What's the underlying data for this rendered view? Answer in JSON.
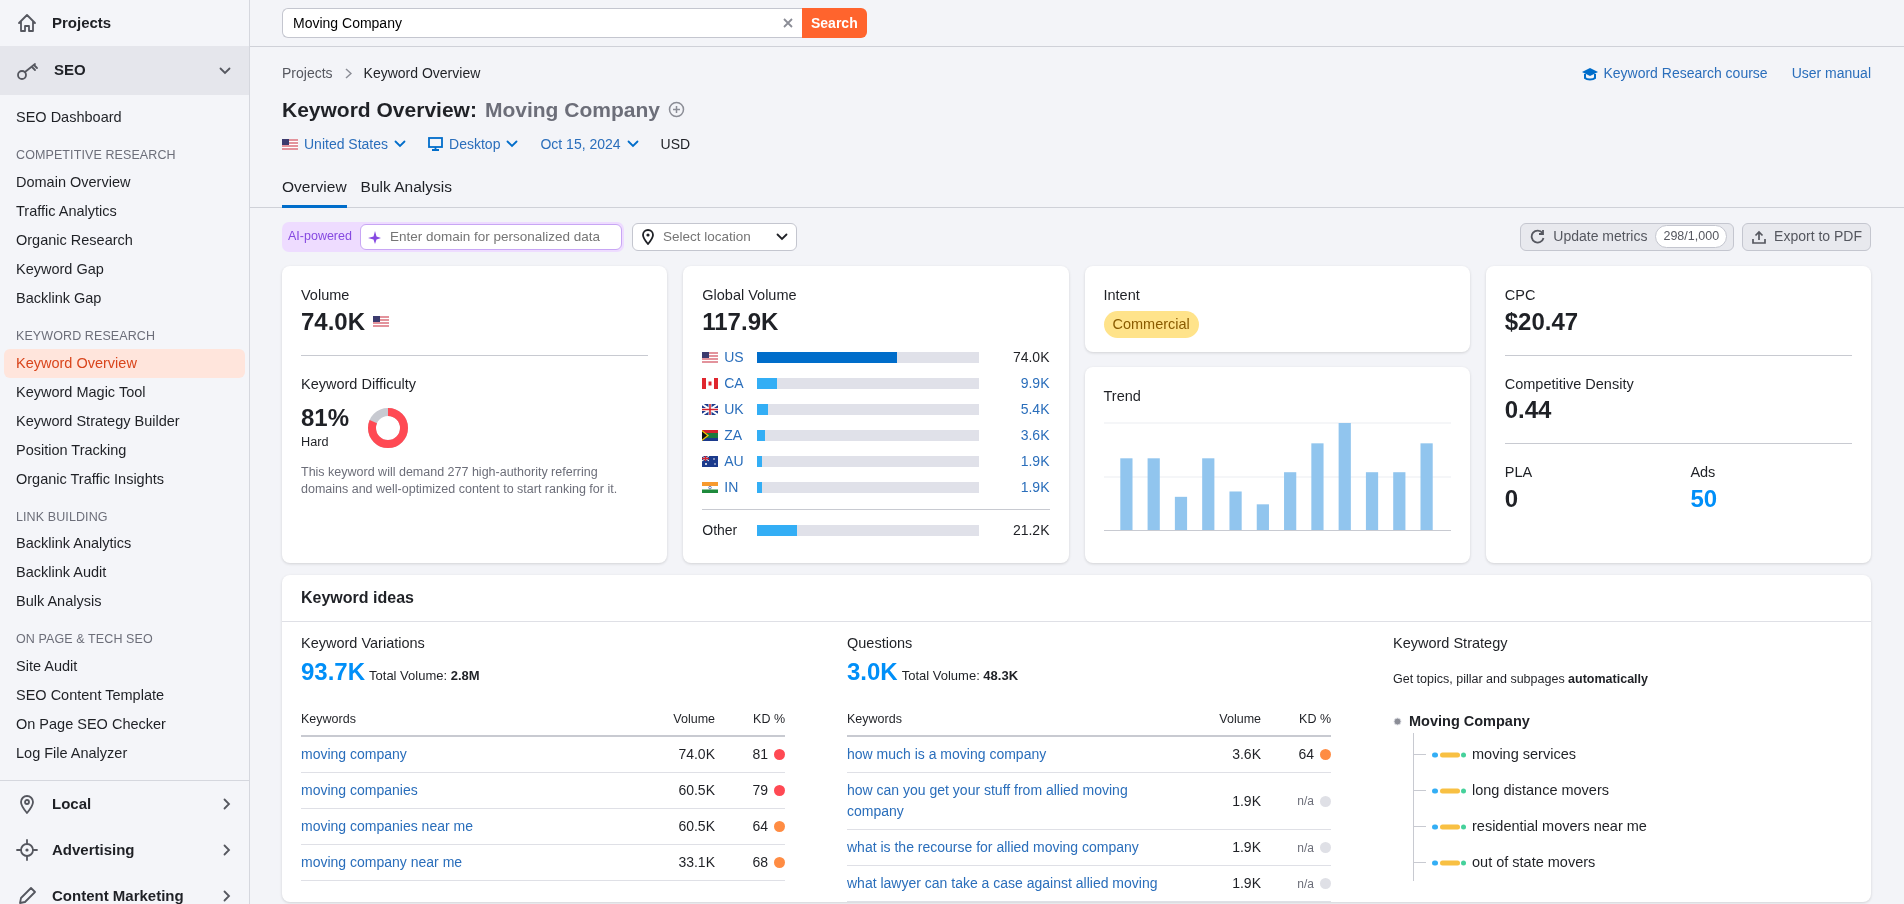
{
  "search": {
    "value": "Moving Company",
    "button": "Search"
  },
  "sidebar": {
    "top": {
      "label": "Projects"
    },
    "groups": [
      {
        "label": "SEO",
        "expanded": true,
        "items": [
          {
            "kind": "link",
            "label": "SEO Dashboard",
            "selected": false
          },
          {
            "kind": "heading",
            "label": "COMPETITIVE RESEARCH"
          },
          {
            "kind": "link",
            "label": "Domain Overview",
            "selected": false
          },
          {
            "kind": "link",
            "label": "Traffic Analytics",
            "selected": false
          },
          {
            "kind": "link",
            "label": "Organic Research",
            "selected": false
          },
          {
            "kind": "link",
            "label": "Keyword Gap",
            "selected": false
          },
          {
            "kind": "link",
            "label": "Backlink Gap",
            "selected": false
          },
          {
            "kind": "heading",
            "label": "KEYWORD RESEARCH"
          },
          {
            "kind": "link",
            "label": "Keyword Overview",
            "selected": true
          },
          {
            "kind": "link",
            "label": "Keyword Magic Tool",
            "selected": false
          },
          {
            "kind": "link",
            "label": "Keyword Strategy Builder",
            "selected": false
          },
          {
            "kind": "link",
            "label": "Position Tracking",
            "selected": false
          },
          {
            "kind": "link",
            "label": "Organic Traffic Insights",
            "selected": false
          },
          {
            "kind": "heading",
            "label": "LINK BUILDING"
          },
          {
            "kind": "link",
            "label": "Backlink Analytics",
            "selected": false
          },
          {
            "kind": "link",
            "label": "Backlink Audit",
            "selected": false
          },
          {
            "kind": "link",
            "label": "Bulk Analysis",
            "selected": false
          },
          {
            "kind": "heading",
            "label": "ON PAGE & TECH SEO"
          },
          {
            "kind": "link",
            "label": "Site Audit",
            "selected": false
          },
          {
            "kind": "link",
            "label": "SEO Content Template",
            "selected": false
          },
          {
            "kind": "link",
            "label": "On Page SEO Checker",
            "selected": false
          },
          {
            "kind": "link",
            "label": "Log File Analyzer",
            "selected": false
          }
        ]
      },
      {
        "label": "Local",
        "expanded": false
      },
      {
        "label": "Advertising",
        "expanded": false
      },
      {
        "label": "Content Marketing",
        "expanded": false
      }
    ]
  },
  "breadcrumb": [
    "Projects",
    "Keyword Overview"
  ],
  "header_links": [
    {
      "label": "Keyword Research course"
    },
    {
      "label": "User manual"
    }
  ],
  "title": "Keyword Overview:",
  "keyword": "Moving Company",
  "selectors": [
    {
      "kind": "country",
      "label": "United States"
    },
    {
      "kind": "device",
      "label": "Desktop"
    },
    {
      "kind": "date",
      "label": "Oct 15, 2024"
    }
  ],
  "currency": "USD",
  "tabs": [
    {
      "label": "Overview",
      "selected": true
    },
    {
      "label": "Bulk Analysis",
      "selected": false
    }
  ],
  "toolbar": {
    "ai_badge": "AI-powered",
    "domain_placeholder": "Enter domain for personalized data",
    "location_placeholder": "Select location",
    "update": "Update metrics",
    "counter": "298/1,000",
    "export": "Export to PDF"
  },
  "volume": {
    "label": "Volume",
    "value": "74.0K"
  },
  "difficulty": {
    "label": "Keyword Difficulty",
    "value": "81%",
    "level": 0.81,
    "rating": "Hard",
    "note": "This keyword will demand 277 high-authority referring domains and well-optimized content to start ranking for it."
  },
  "global_volume": {
    "label": "Global Volume",
    "value": "117.9K",
    "countries": [
      {
        "code": "US",
        "level": 0.63,
        "value": "74.0K",
        "linked": false
      },
      {
        "code": "CA",
        "level": 0.09,
        "value": "9.9K",
        "linked": true
      },
      {
        "code": "UK",
        "level": 0.05,
        "value": "5.4K",
        "linked": true
      },
      {
        "code": "ZA",
        "level": 0.035,
        "value": "3.6K",
        "linked": true
      },
      {
        "code": "AU",
        "level": 0.02,
        "value": "1.9K",
        "linked": true
      },
      {
        "code": "IN",
        "level": 0.02,
        "value": "1.9K",
        "linked": true
      }
    ],
    "other": {
      "label": "Other",
      "level": 0.18,
      "value": "21.2K"
    }
  },
  "intent": {
    "label": "Intent",
    "tag": "Commercial"
  },
  "trend": {
    "label": "Trend"
  },
  "cpc": {
    "metrics": [
      {
        "label": "CPC",
        "value": "$20.47"
      },
      {
        "label": "Competitive Density",
        "value": "0.44"
      }
    ],
    "pair": [
      {
        "label": "PLA",
        "value": "0",
        "linked": false
      },
      {
        "label": "Ads",
        "value": "50",
        "linked": true
      }
    ]
  },
  "keyword_ideas": {
    "title": "Keyword ideas",
    "lists": [
      {
        "label": "Keyword Variations",
        "count": "93.7K",
        "total_label": "Total Volume:",
        "total": "2.8M",
        "columns": [
          "Keywords",
          "Volume",
          "KD %"
        ],
        "rows": [
          {
            "keyword": "moving company",
            "volume": "74.0K",
            "kd": "81",
            "kind": "score",
            "color": "#ff4953"
          },
          {
            "keyword": "moving companies",
            "volume": "60.5K",
            "kd": "79",
            "kind": "score",
            "color": "#ff4953"
          },
          {
            "keyword": "moving companies near me",
            "volume": "60.5K",
            "kd": "64",
            "kind": "score",
            "color": "#ff8c43"
          },
          {
            "keyword": "moving company near me",
            "volume": "33.1K",
            "kd": "68",
            "kind": "score",
            "color": "#ff8c43"
          }
        ]
      },
      {
        "label": "Questions",
        "count": "3.0K",
        "total_label": "Total Volume:",
        "total": "48.3K",
        "columns": [
          "Keywords",
          "Volume",
          "KD %"
        ],
        "rows": [
          {
            "keyword": "how much is a moving company",
            "volume": "3.6K",
            "kd": "64",
            "kind": "score",
            "color": "#ff8c43"
          },
          {
            "keyword": "how can you get your stuff from allied moving company",
            "volume": "1.9K",
            "kd": "n/a",
            "kind": "na",
            "color": "#dfe0e6"
          },
          {
            "keyword": "what is the recourse for allied moving company",
            "volume": "1.9K",
            "kd": "n/a",
            "kind": "na",
            "color": "#dfe0e6"
          },
          {
            "keyword": "what lawyer can take a case against allied moving",
            "volume": "1.9K",
            "kd": "n/a",
            "kind": "na",
            "color": "#dfe0e6"
          }
        ]
      }
    ],
    "strategy": {
      "label": "Keyword Strategy",
      "subtitle": "Get topics, pillar and subpages **automatically**",
      "root": "Moving Company",
      "children": [
        {
          "label": "moving services"
        },
        {
          "label": "long distance movers"
        },
        {
          "label": "residential movers near me"
        },
        {
          "label": "out of state movers"
        }
      ]
    }
  }
}
